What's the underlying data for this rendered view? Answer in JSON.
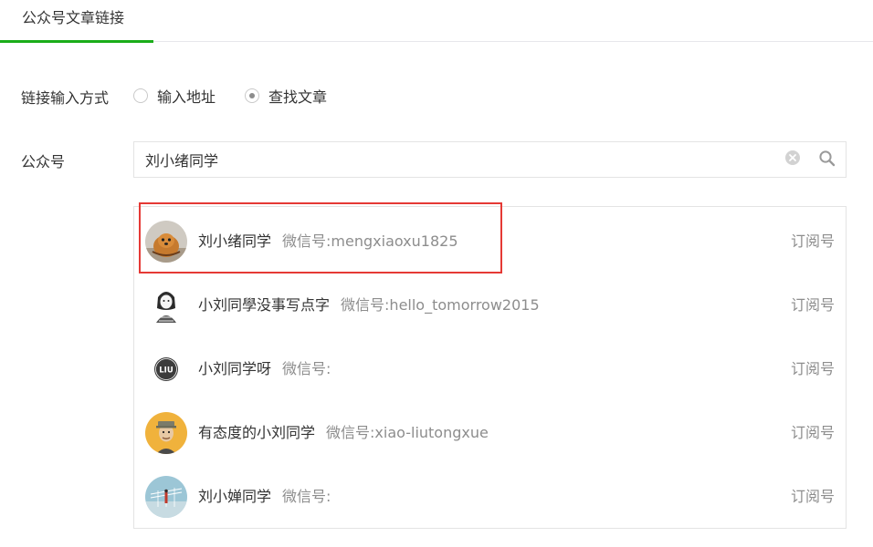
{
  "tabs": [
    {
      "label": "公众号文章链接",
      "active": true
    }
  ],
  "link_method": {
    "label": "链接输入方式",
    "options": [
      {
        "label": "输入地址",
        "checked": false
      },
      {
        "label": "查找文章",
        "checked": true
      }
    ]
  },
  "account": {
    "label": "公众号",
    "search_value": "刘小绪同学"
  },
  "results": [
    {
      "name": "刘小绪同学",
      "wechat_label": "微信号:",
      "wechat_id": "mengxiaoxu1825",
      "type": "订阅号",
      "avatar": "dog-avatar-icon"
    },
    {
      "name": "小刘同學没事写点字",
      "wechat_label": "微信号:",
      "wechat_id": "hello_tomorrow2015",
      "type": "订阅号",
      "avatar": "sketch-girl-avatar-icon"
    },
    {
      "name": "小刘同学呀",
      "wechat_label": "微信号:",
      "wechat_id": "",
      "type": "订阅号",
      "avatar": "liu-badge-avatar-icon"
    },
    {
      "name": "有态度的小刘同学",
      "wechat_label": "微信号:",
      "wechat_id": "xiao-liutongxue",
      "type": "订阅号",
      "avatar": "cartoon-man-avatar-icon"
    },
    {
      "name": "刘小婵同学",
      "wechat_label": "微信号:",
      "wechat_id": "",
      "type": "订阅号",
      "avatar": "landscape-avatar-icon"
    }
  ],
  "colors": {
    "accent": "#1aad19",
    "highlight_border": "#e53935"
  }
}
